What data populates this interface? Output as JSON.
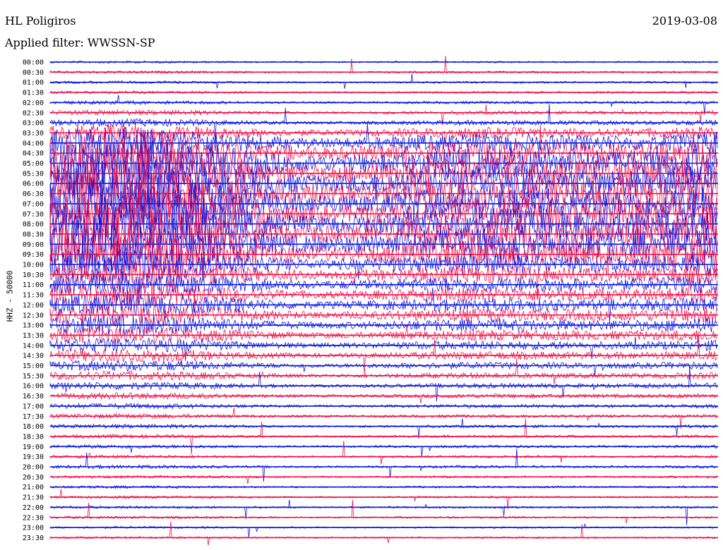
{
  "header": {
    "station": "HL Poligiros",
    "date": "2019-03-08",
    "filter": "Applied filter: WWSSN-SP"
  },
  "chart_data": {
    "type": "line",
    "title": "HL Poligiros",
    "ylabel": "HHZ - 50000",
    "colors": [
      "#0b17e0",
      "#f0104a"
    ],
    "rows": [
      "00:00",
      "00:30",
      "01:00",
      "01:30",
      "02:00",
      "02:30",
      "03:00",
      "03:30",
      "04:00",
      "04:30",
      "05:00",
      "05:30",
      "06:00",
      "06:30",
      "07:00",
      "07:30",
      "08:00",
      "08:30",
      "09:00",
      "09:30",
      "10:00",
      "10:30",
      "11:00",
      "11:30",
      "12:00",
      "12:30",
      "13:00",
      "13:30",
      "14:00",
      "14:30",
      "15:00",
      "15:30",
      "16:00",
      "16:30",
      "17:00",
      "17:30",
      "18:00",
      "18:30",
      "19:00",
      "19:30",
      "20:00",
      "20:30",
      "21:00",
      "21:30",
      "22:00",
      "22:30",
      "23:00",
      "23:30"
    ],
    "activity_level": [
      0.02,
      0.03,
      0.03,
      0.03,
      0.05,
      0.08,
      0.12,
      0.3,
      0.55,
      0.75,
      0.9,
      1.0,
      1.0,
      1.0,
      1.0,
      1.0,
      1.0,
      1.0,
      1.0,
      0.85,
      0.6,
      0.5,
      0.45,
      0.42,
      0.4,
      0.38,
      0.35,
      0.3,
      0.25,
      0.22,
      0.18,
      0.15,
      0.12,
      0.1,
      0.08,
      0.07,
      0.06,
      0.05,
      0.05,
      0.04,
      0.05,
      0.03,
      0.03,
      0.03,
      0.03,
      0.03,
      0.02,
      0.02
    ]
  }
}
